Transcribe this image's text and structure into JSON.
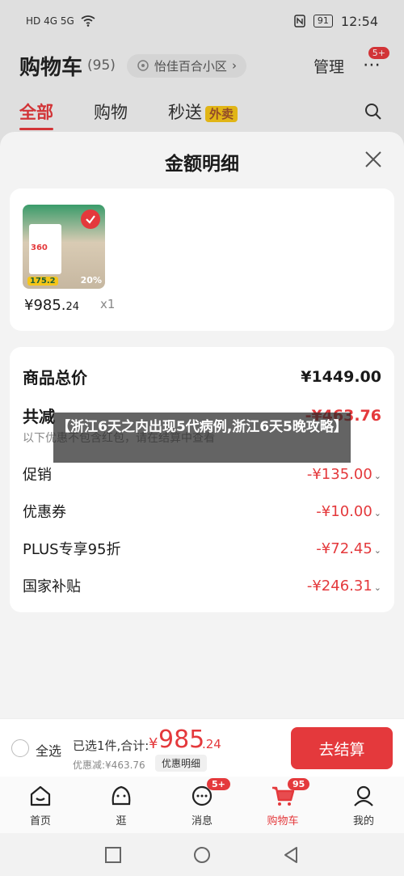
{
  "status_bar": {
    "left": "HD 4G 5G",
    "battery": "91",
    "time": "12:54"
  },
  "header": {
    "title": "购物车",
    "count": "(95)",
    "location": "怡佳百合小区",
    "manage": "管理",
    "more_badge": "5+"
  },
  "tabs": [
    {
      "label": "全部"
    },
    {
      "label": "购物"
    },
    {
      "label": "秒送",
      "tag": "外卖"
    }
  ],
  "sheet": {
    "title": "金额明细",
    "product": {
      "price_int": "¥985.",
      "price_dec": "24",
      "qty": "x1",
      "thumb_price": "175.2",
      "thumb_pct": "20%",
      "thumb_box_text": "360"
    },
    "rows": {
      "total_label": "商品总价",
      "total_value": "¥1449.00",
      "reduce_label": "共减",
      "reduce_value": "-¥463.76",
      "reduce_note": "以下优惠不包含红包，请在结算中查看",
      "promo_label": "促销",
      "promo_value": "-¥135.00",
      "coupon_label": "优惠券",
      "coupon_value": "-¥10.00",
      "plus_label": "PLUS专享95折",
      "plus_value": "-¥72.45",
      "subsidy_label": "国家补贴",
      "subsidy_value": "-¥246.31"
    }
  },
  "banner": {
    "text": "【浙江6天之内出现5代病例,浙江6天5晚攻略】"
  },
  "checkout": {
    "select_all": "全选",
    "selected": "已选1件,合计:",
    "yen": "¥",
    "total_int": "985",
    "total_dec": ".24",
    "discount": "优惠减:¥463.76",
    "detail_button": "优惠明细",
    "checkout_button": "去结算"
  },
  "bottom_nav": [
    {
      "label": "首页"
    },
    {
      "label": "逛"
    },
    {
      "label": "消息",
      "badge": "5+"
    },
    {
      "label": "购物车",
      "badge": "95"
    },
    {
      "label": "我的"
    }
  ],
  "colors": {
    "accent": "#e4393c",
    "tag_yellow": "#f5c518"
  }
}
